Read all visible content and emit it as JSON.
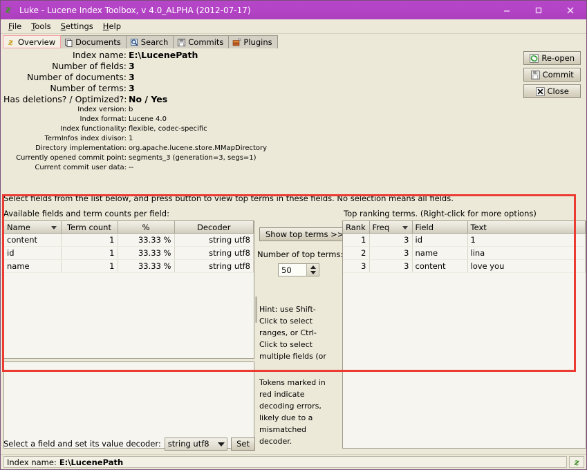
{
  "window": {
    "title": "Luke - Lucene Index Toolbox, v 4.0_ALPHA (2012-07-17)",
    "logo_icon": "luke-logo-icon",
    "minimize_label": "–",
    "maximize_label": "□",
    "close_label": "✕"
  },
  "menubar": {
    "items": [
      {
        "label": "File",
        "mnemonic": "F",
        "rest": "ile"
      },
      {
        "label": "Tools",
        "mnemonic": "T",
        "rest": "ools"
      },
      {
        "label": "Settings",
        "mnemonic": "S",
        "rest": "ettings"
      },
      {
        "label": "Help",
        "mnemonic": "H",
        "rest": "elp"
      }
    ]
  },
  "tabs": [
    {
      "label": "Overview",
      "icon": "luke-overview-icon",
      "selected": true
    },
    {
      "label": "Documents",
      "icon": "documents-icon",
      "selected": false
    },
    {
      "label": "Search",
      "icon": "search-magnifier-icon",
      "selected": false
    },
    {
      "label": "Commits",
      "icon": "floppy-disk-icon",
      "selected": false
    },
    {
      "label": "Plugins",
      "icon": "plugins-icon",
      "selected": false
    }
  ],
  "overview": {
    "info_rows": [
      {
        "label": "Index name:",
        "value": "E:\\LucenePath",
        "size": "big"
      },
      {
        "label": "Number of fields:",
        "value": "3",
        "size": "big"
      },
      {
        "label": "Number of documents:",
        "value": "3",
        "size": "big"
      },
      {
        "label": "Number of terms:",
        "value": "3",
        "size": "big"
      },
      {
        "label": "Has deletions? / Optimized?:",
        "value": "No / Yes",
        "size": "big"
      },
      {
        "label": "Index version:",
        "value": "b",
        "size": "small"
      },
      {
        "label": "Index format:",
        "value": "Lucene 4.0",
        "size": "small"
      },
      {
        "label": "Index functionality:",
        "value": "flexible, codec-specific",
        "size": "small"
      },
      {
        "label": "TermInfos index divisor:",
        "value": "1",
        "size": "small"
      },
      {
        "label": "Directory implementation:",
        "value": "org.apache.lucene.store.MMapDirectory",
        "size": "small"
      },
      {
        "label": "Currently opened commit point:",
        "value": "segments_3 (generation=3, segs=1)",
        "size": "small"
      },
      {
        "label": "Current commit user data:",
        "value": "--",
        "size": "small"
      }
    ],
    "buttons": [
      {
        "label": "Re-open",
        "icon": "refresh-icon"
      },
      {
        "label": "Commit",
        "icon": "floppy-disk-icon"
      },
      {
        "label": "Close",
        "icon": "close-x-icon"
      }
    ],
    "instruction": "Select fields from the list below, and press button to view top terms in these fields. No selection means all fields.",
    "fields_label": "Available fields and term counts per field:",
    "fields_table": {
      "columns": [
        "Name",
        "Term count",
        "%",
        "Decoder"
      ],
      "sorted_column": "Name",
      "rows": [
        {
          "name": "content",
          "term_count": "1",
          "pct": "33.33 %",
          "decoder": "string utf8"
        },
        {
          "name": "id",
          "term_count": "1",
          "pct": "33.33 %",
          "decoder": "string utf8"
        },
        {
          "name": "name",
          "term_count": "1",
          "pct": "33.33 %",
          "decoder": "string utf8"
        }
      ]
    },
    "show_top_terms_button": "Show top terms >>",
    "num_top_terms_label": "Number of top terms:",
    "num_top_terms_value": "50",
    "hint_selection": "Hint: use Shift-Click to select ranges, or Ctrl-Click to select multiple fields (or unselect all).",
    "hint_decoding": "Tokens marked in red indicate decoding errors, likely due to a mismatched decoder.",
    "top_terms_label": "Top ranking terms. (Right-click for more options)",
    "top_terms_table": {
      "columns": [
        "Rank",
        "Freq",
        "Field",
        "Text"
      ],
      "sorted_column": "Freq",
      "rows": [
        {
          "rank": "1",
          "freq": "3",
          "field": "id",
          "text": "1"
        },
        {
          "rank": "2",
          "freq": "3",
          "field": "name",
          "text": "lina"
        },
        {
          "rank": "3",
          "freq": "3",
          "field": "content",
          "text": "love you"
        }
      ]
    },
    "decoder_bar": {
      "label": "Select a field and set its value decoder:",
      "selected_decoder": "string utf8",
      "set_button": "Set"
    }
  },
  "statusbar": {
    "label": "Index name:",
    "value": "E:\\LucenePath",
    "logo_icon": "luke-logo-icon"
  },
  "annotation": {
    "highlight_color": "#ec3b33"
  },
  "colors": {
    "titlebar": "#b444c6",
    "panel": "#ece9d8",
    "table_bg": "#f6f5f0",
    "tab_selected_border": "#f2a0a0"
  }
}
